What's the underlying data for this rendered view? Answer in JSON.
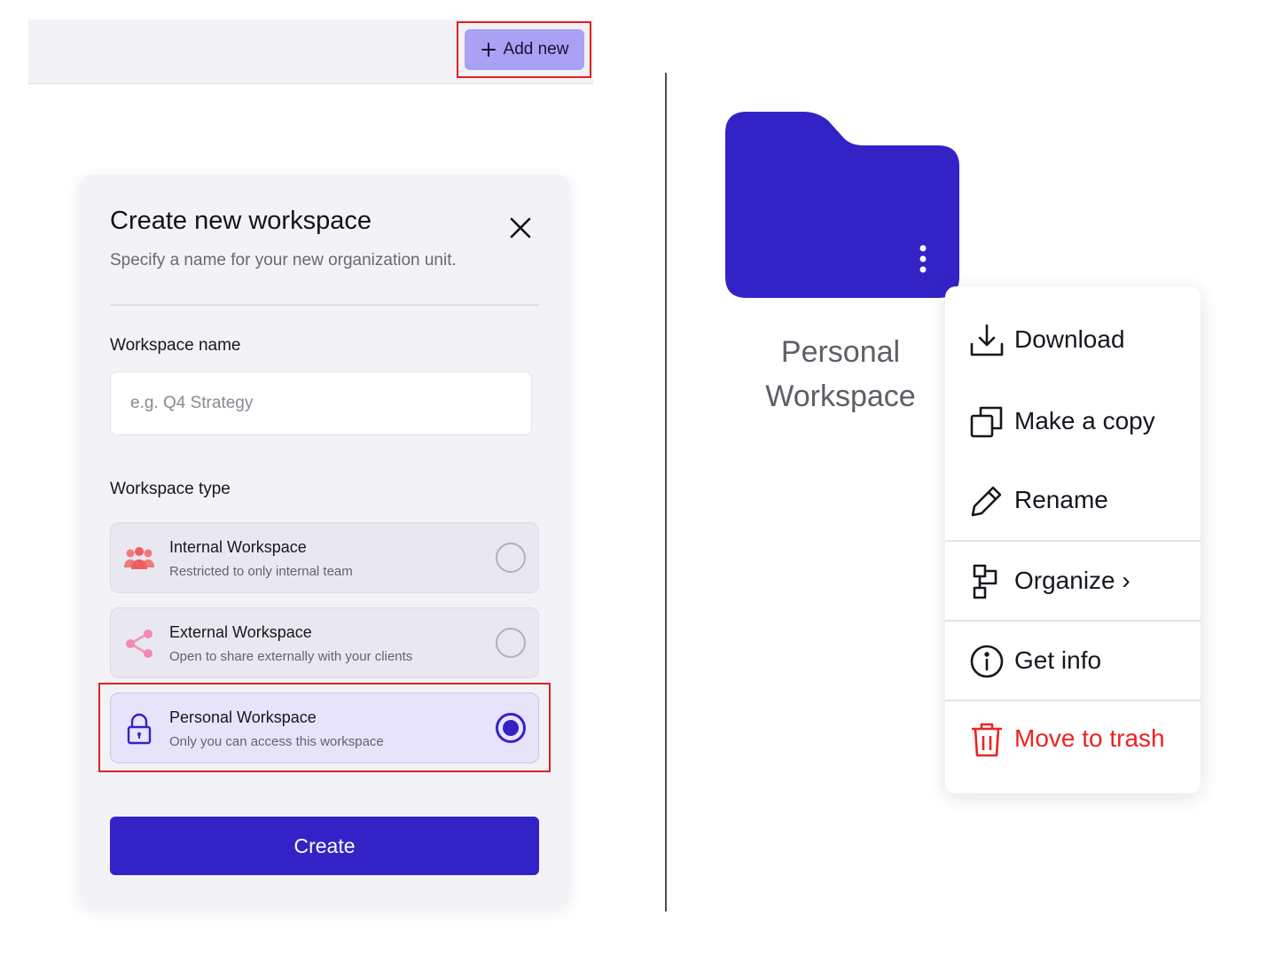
{
  "topbar": {
    "add_new_label": "Add new"
  },
  "modal": {
    "title": "Create new workspace",
    "subtitle": "Specify a name for your new organization unit.",
    "name_label": "Workspace name",
    "name_placeholder": "e.g. Q4 Strategy",
    "name_value": "",
    "type_label": "Workspace type",
    "options": [
      {
        "title": "Internal Workspace",
        "desc": "Restricted to only internal team",
        "icon": "people-icon",
        "selected": false
      },
      {
        "title": "External Workspace",
        "desc": "Open to share externally with your clients",
        "icon": "share-icon",
        "selected": false
      },
      {
        "title": "Personal Workspace",
        "desc": "Only you can access this workspace",
        "icon": "lock-icon",
        "selected": true
      }
    ],
    "create_label": "Create"
  },
  "folder": {
    "label": "Personal Workspace",
    "color": "#3323c7",
    "icon": "folder-icon"
  },
  "menu": {
    "items": [
      {
        "label": "Download",
        "icon": "download-icon"
      },
      {
        "label": "Make a copy",
        "icon": "copy-icon"
      },
      {
        "label": "Rename",
        "icon": "pencil-icon"
      },
      {
        "label": "Organize ›",
        "icon": "organize-icon"
      },
      {
        "label": "Get info",
        "icon": "info-icon"
      },
      {
        "label": "Move to trash",
        "icon": "trash-icon"
      }
    ]
  },
  "colors": {
    "primary": "#3323c7",
    "accent": "#a9a1f3",
    "danger": "#ee2222",
    "highlight": "#e0201f"
  }
}
